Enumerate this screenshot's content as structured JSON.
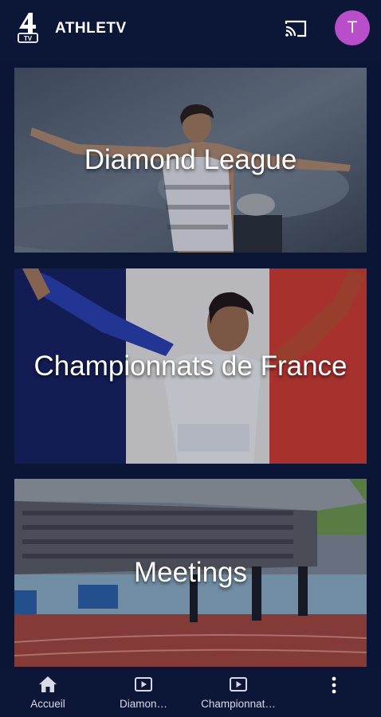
{
  "app": {
    "title": "ATHLETV",
    "logo_text": "TV",
    "avatar_letter": "T"
  },
  "cards": [
    {
      "label": "Diamond League"
    },
    {
      "label": "Championnats de France"
    },
    {
      "label": "Meetings"
    }
  ],
  "bottom_nav": {
    "items": [
      {
        "label": "Accueil",
        "icon": "home-icon"
      },
      {
        "label": "Diamon…",
        "icon": "video-icon"
      },
      {
        "label": "Championnat…",
        "icon": "video-icon"
      }
    ],
    "more_icon": "more-vertical-icon"
  },
  "colors": {
    "background": "#0b1535",
    "avatar": "#b84ec9",
    "accent_red": "#d23a2e",
    "accent_blue": "#1b2b8a"
  }
}
